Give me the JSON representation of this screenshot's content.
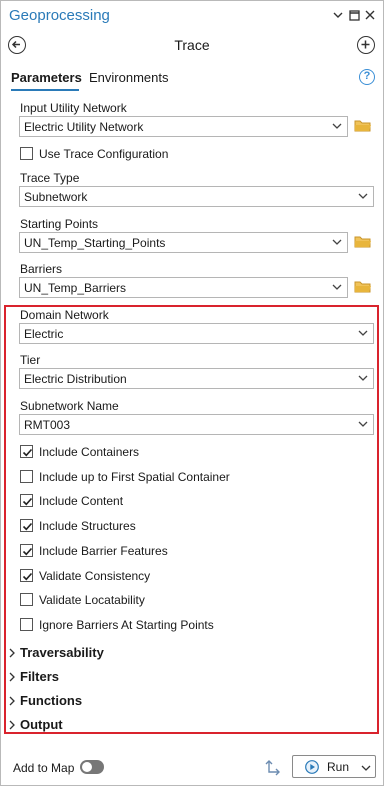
{
  "window": {
    "title": "Geoprocessing",
    "tool_title": "Trace"
  },
  "tabs": {
    "parameters": "Parameters",
    "environments": "Environments"
  },
  "fields": {
    "input_network": {
      "label": "Input Utility Network",
      "value": "Electric Utility Network"
    },
    "use_trace_config": {
      "label": "Use Trace Configuration",
      "checked": false
    },
    "trace_type": {
      "label": "Trace Type",
      "value": "Subnetwork"
    },
    "starting_points": {
      "label": "Starting Points",
      "value": "UN_Temp_Starting_Points"
    },
    "barriers": {
      "label": "Barriers",
      "value": "UN_Temp_Barriers"
    },
    "domain_network": {
      "label": "Domain Network",
      "value": "Electric"
    },
    "tier": {
      "label": "Tier",
      "value": "Electric Distribution"
    },
    "subnetwork_name": {
      "label": "Subnetwork Name",
      "value": "RMT003"
    }
  },
  "options": [
    {
      "label": "Include Containers",
      "checked": true
    },
    {
      "label": "Include up to First Spatial Container",
      "checked": false
    },
    {
      "label": "Include Content",
      "checked": true
    },
    {
      "label": "Include Structures",
      "checked": true
    },
    {
      "label": "Include Barrier Features",
      "checked": true
    },
    {
      "label": "Validate Consistency",
      "checked": true
    },
    {
      "label": "Validate Locatability",
      "checked": false
    },
    {
      "label": "Ignore Barriers At Starting Points",
      "checked": false
    }
  ],
  "sections": [
    "Traversability",
    "Filters",
    "Functions",
    "Output"
  ],
  "footer": {
    "add_to_map": "Add to Map",
    "add_to_map_on": false,
    "run": "Run"
  },
  "colors": {
    "accent": "#2a7ab8",
    "highlight_box": "#d9232d",
    "folder": "#e8b53c"
  }
}
